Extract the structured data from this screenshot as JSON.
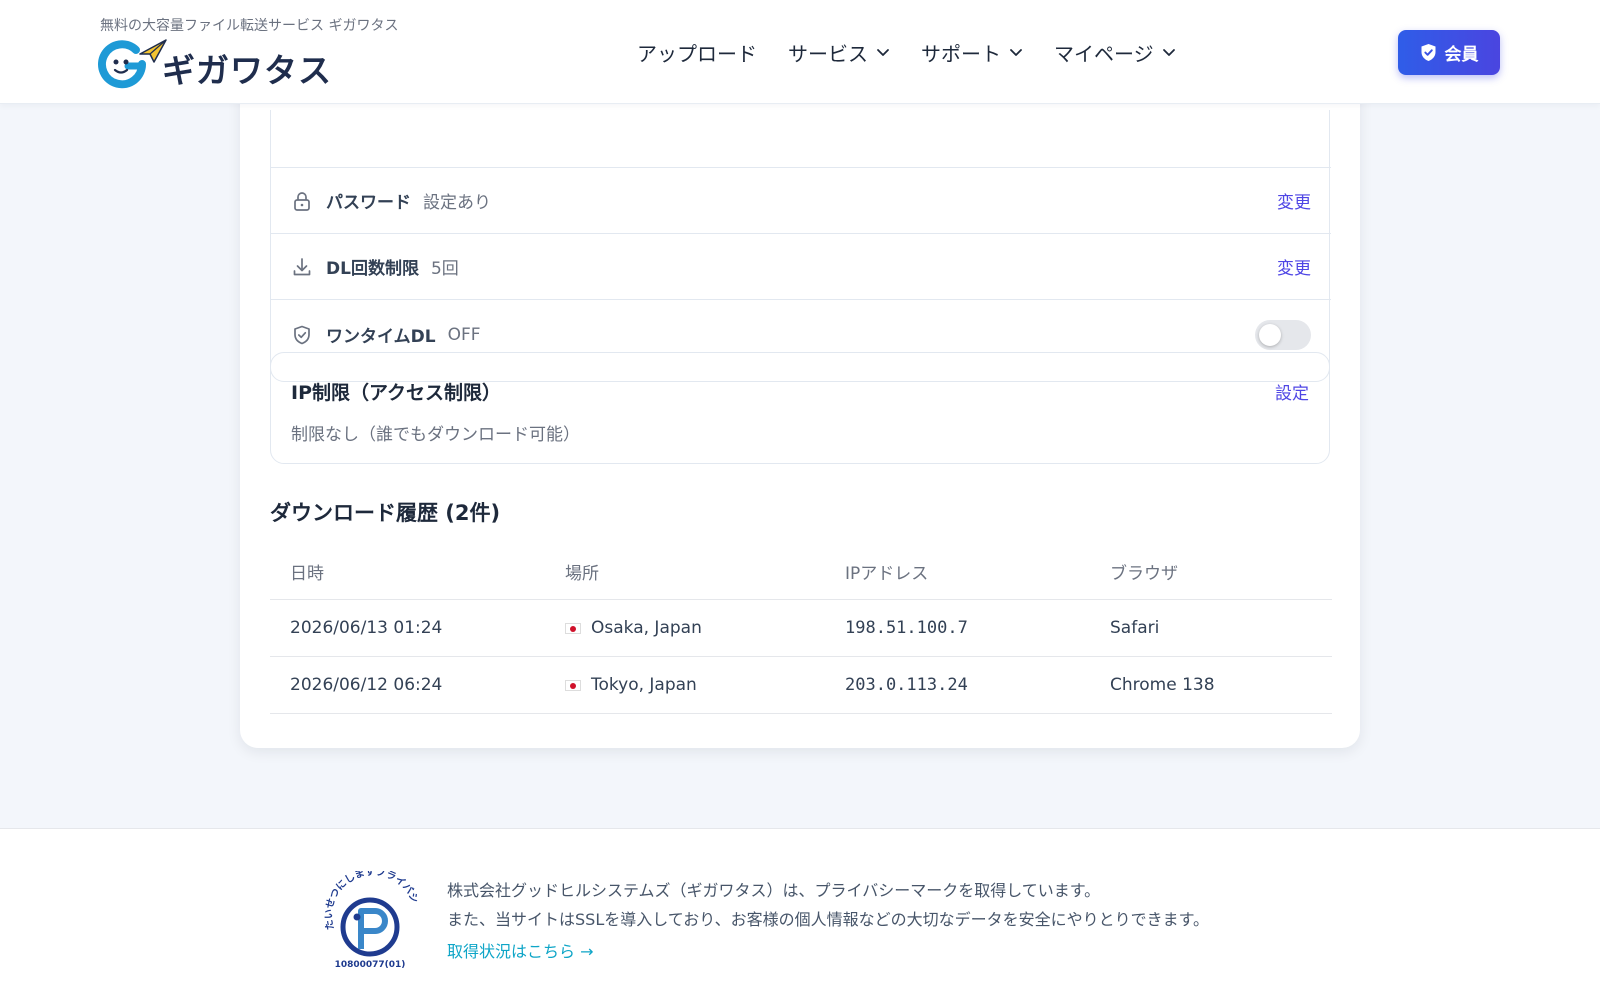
{
  "header": {
    "tagline": "無料の大容量ファイル転送サービス ギガワタス",
    "logo_text": "ギガワタス",
    "nav": [
      {
        "label": "アップロード",
        "has_dropdown": false
      },
      {
        "label": "サービス",
        "has_dropdown": true
      },
      {
        "label": "サポート",
        "has_dropdown": true
      },
      {
        "label": "マイページ",
        "has_dropdown": true
      }
    ],
    "member_button": "会員"
  },
  "settings": {
    "password": {
      "label": "パスワード",
      "value": "設定あり",
      "action": "変更"
    },
    "dl_limit": {
      "label": "DL回数制限",
      "value": "5回",
      "action": "変更"
    },
    "onetime": {
      "label": "ワンタイムDL",
      "value": "OFF",
      "enabled": false
    }
  },
  "ip_restriction": {
    "title": "IP制限（アクセス制限）",
    "action": "設定",
    "description": "制限なし（誰でもダウンロード可能）"
  },
  "history": {
    "title": "ダウンロード履歴 (2件)",
    "columns": [
      "日時",
      "場所",
      "IPアドレス",
      "ブラウザ"
    ],
    "rows": [
      {
        "datetime": "2026/06/13 01:24",
        "location": "Osaka, Japan",
        "ip": "198.51.100.7",
        "browser": "Safari"
      },
      {
        "datetime": "2026/06/12 06:24",
        "location": "Tokyo, Japan",
        "ip": "203.0.113.24",
        "browser": "Chrome 138"
      }
    ]
  },
  "footer": {
    "line1": "株式会社グッドヒルシステムズ（ギガワタス）は、プライバシーマークを取得しています。",
    "line2": "また、当サイトはSSLを導入しており、お客様の個人情報などの大切なデータを安全にやりとりできます。",
    "link": "取得状況はこちら →",
    "pmark_arc_text": "たいせつにしますプライバシー",
    "pmark_number": "10800077(01)"
  },
  "colors": {
    "accent": "#4f46e5",
    "member_button": "#2f5de8",
    "link": "#0ea5c7",
    "logo_blue": "#1e9ad6",
    "logo_yellow": "#f4c430"
  }
}
